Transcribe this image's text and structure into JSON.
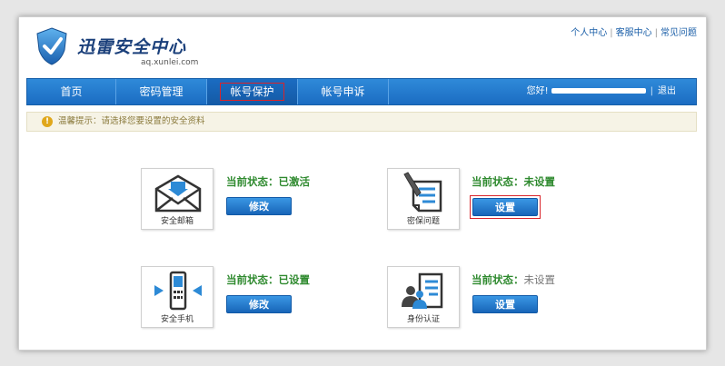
{
  "header": {
    "logo_title": "迅雷安全中心",
    "logo_domain": "aq.xunlei.com",
    "top_links": [
      "个人中心",
      "客服中心",
      "常见问题"
    ]
  },
  "nav": {
    "items": [
      {
        "label": "首页"
      },
      {
        "label": "密码管理"
      },
      {
        "label": "帐号保护",
        "active": true
      },
      {
        "label": "帐号申诉"
      }
    ],
    "greeting": "您好!",
    "logout": "退出"
  },
  "tip": {
    "text": "温馨提示：请选择您要设置的安全资料"
  },
  "cards": [
    {
      "icon": "envelope-icon",
      "label": "安全邮箱",
      "status_label": "当前状态：",
      "status_value": "已激活",
      "button": "修改"
    },
    {
      "icon": "question-doc-icon",
      "label": "密保问题",
      "status_label": "当前状态：",
      "status_value": "未设置",
      "button": "设置"
    },
    {
      "icon": "phone-icon",
      "label": "安全手机",
      "status_label": "当前状态：",
      "status_value": "已设置",
      "button": "修改"
    },
    {
      "icon": "id-card-icon",
      "label": "身份认证",
      "status_label": "当前状态：",
      "status_value": "未设置",
      "button": "设置"
    }
  ],
  "colors": {
    "nav_blue": "#1b6cc2",
    "status_green": "#2f8a2f",
    "highlight_red": "#d9242a"
  }
}
